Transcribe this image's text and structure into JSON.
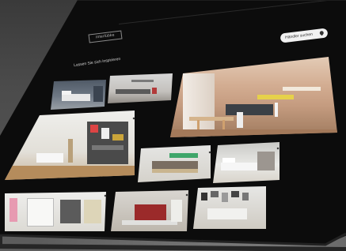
{
  "app": {
    "logo_text": "interlübke",
    "nav_items": [
      "",
      "",
      "",
      "",
      ""
    ],
    "cta_label": "Händler suchen",
    "heading": "Lassen Sie sich inspirieren",
    "subheading": ""
  },
  "tiles": [
    {
      "name": "tile-bedroom-small"
    },
    {
      "name": "tile-living-shelf-small"
    },
    {
      "name": "tile-featured-dining"
    },
    {
      "name": "tile-large-wall-unit"
    },
    {
      "name": "tile-sideboard"
    },
    {
      "name": "tile-bedroom-wide"
    },
    {
      "name": "tile-wardrobe"
    },
    {
      "name": "tile-red-interior"
    },
    {
      "name": "tile-gallery-wall"
    }
  ],
  "colors": {
    "screen_background": "#0c0c0c",
    "wall_warm": "#c8a48e",
    "wood": "#b8895a",
    "accent_red": "#9b2a2a"
  }
}
